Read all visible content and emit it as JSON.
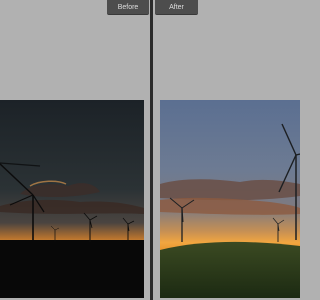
{
  "tabs": {
    "before_label": "Before",
    "after_label": "After"
  },
  "colors": {
    "panel_bg": "#b1b1b1",
    "divider": "#2a2a2a",
    "tab_bg": "#4d4d4d",
    "tab_text": "#dedede",
    "sunset_orange": "#f0a23c"
  },
  "images": {
    "before_subject": "wind-turbines-at-sunset",
    "after_subject": "wind-turbines-at-sunset-edited"
  }
}
